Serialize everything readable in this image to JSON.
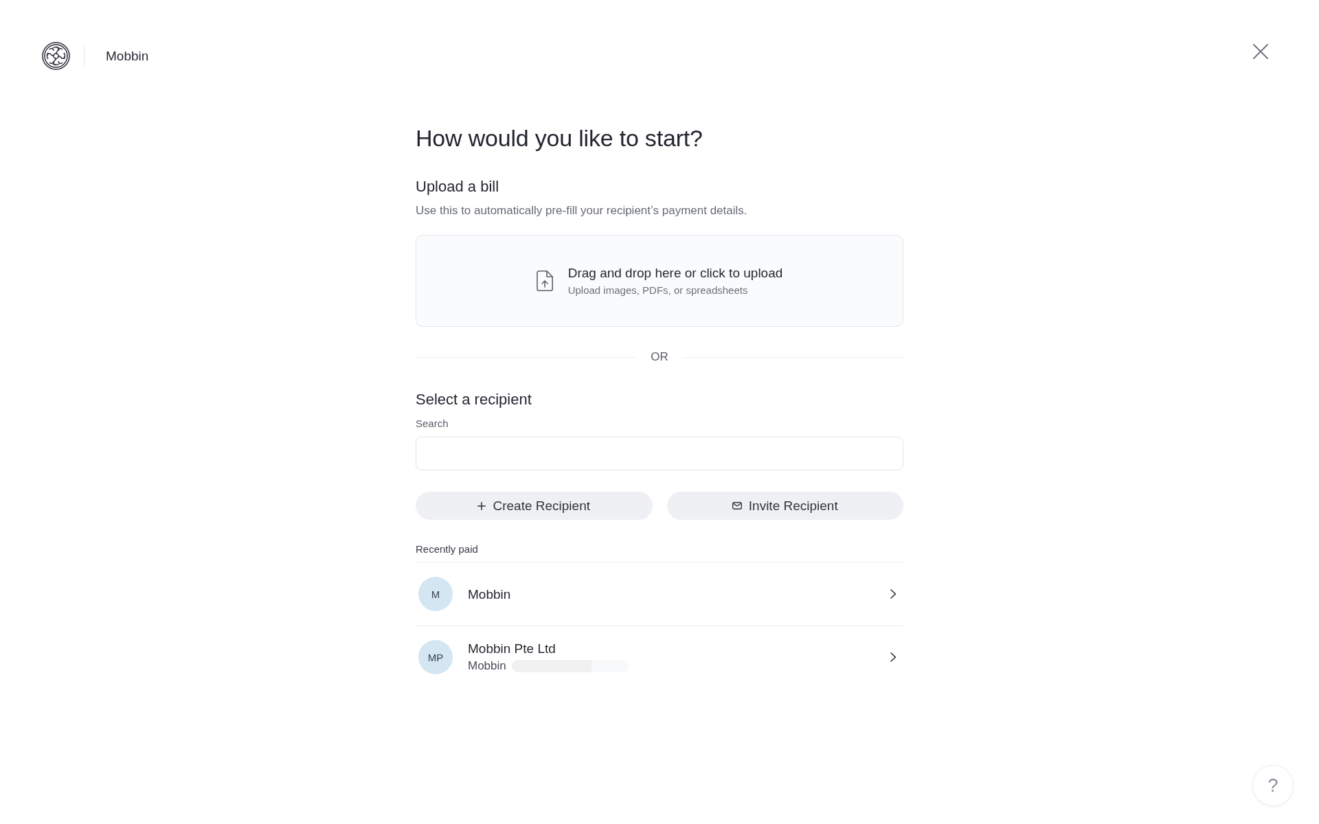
{
  "header": {
    "brand": "Mobbin"
  },
  "title": "How would you like to start?",
  "upload_section": {
    "heading": "Upload a bill",
    "description": "Use this to automatically pre-fill your recipient’s payment details.",
    "dropzone": {
      "title": "Drag and drop here or click to upload",
      "hint": "Upload images, PDFs, or spreadsheets"
    }
  },
  "divider": {
    "label": "OR"
  },
  "recipient_section": {
    "heading": "Select a recipient",
    "search": {
      "label": "Search"
    },
    "actions": [
      {
        "kind": "create",
        "label": "Create Recipient"
      },
      {
        "kind": "invite",
        "label": "Invite Recipient"
      }
    ]
  },
  "recently_paid": {
    "heading": "Recently paid",
    "items": [
      {
        "initials": "M",
        "name": "Mobbin",
        "redacted": false
      },
      {
        "initials": "MP",
        "name": "Mobbin Pte Ltd",
        "subtitle": "Mobbin",
        "redacted": true
      }
    ]
  },
  "help_button": {
    "label": "?"
  }
}
